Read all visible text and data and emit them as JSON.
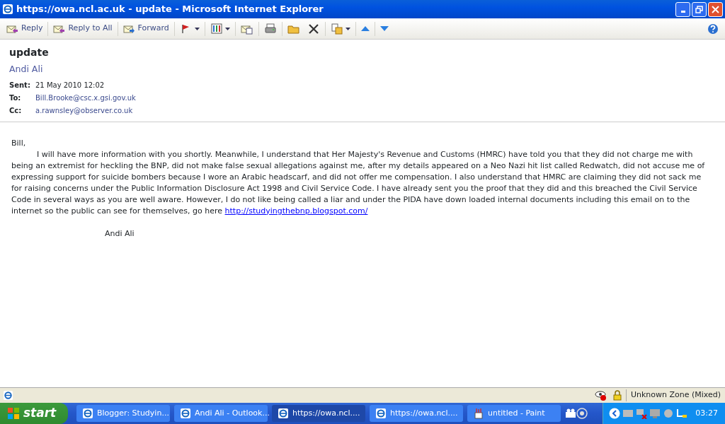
{
  "window": {
    "title": "https://owa.ncl.ac.uk - update - Microsoft Internet Explorer"
  },
  "toolbar": [
    {
      "label": "Reply",
      "has_menu": false
    },
    {
      "label": "Reply to All",
      "has_menu": false
    },
    {
      "label": "Forward",
      "has_menu": false
    },
    {
      "has_menu": true
    },
    {
      "has_menu": true
    },
    {
      "has_menu": false
    },
    {
      "has_menu": false
    },
    {
      "has_menu": false
    },
    {
      "has_menu": false
    },
    {
      "has_menu": true
    },
    {
      "has_menu": false
    },
    {
      "has_menu": false
    }
  ],
  "message": {
    "subject": "update",
    "sender": "Andi Ali",
    "fields": [
      {
        "label": "Sent:",
        "value": "21 May 2010 12:02",
        "kind": "text"
      },
      {
        "label": "To:",
        "value": "Bill.Brooke@csc.x.gsi.gov.uk",
        "kind": "address"
      },
      {
        "label": "Cc:",
        "value": "a.rawnsley@observer.co.uk",
        "kind": "address"
      }
    ],
    "greeting": "Bill,",
    "body": "I will have more information with you shortly. Meanwhile, I understand that Her Majesty's Revenue and Customs (HMRC) have told you that they did not charge me with being an extremist for heckling the BNP, did not make false sexual allegations against me, after my details appeared on a Neo Nazi hit list called Redwatch, did not  accuse me of expressing support for suicide bombers because I wore an Arabic headscarf, and did not offer me compensation. I also understand that HMRC are claiming they did not sack me for raising concerns under the Public Information Disclosure Act 1998 and Civil Service Code. I have already sent you the proof that they did and this breached the Civil Service Code in several ways as you are well aware. However, I do not like being called a liar and under the PIDA have down loaded internal documents including this email on to the internet so the public can see for themselves, go here",
    "link": "http://studyingthebnp.blogspot.com/",
    "signature": "Andi Ali"
  },
  "status_bar": {
    "zone": "Unknown Zone (Mixed)"
  },
  "taskbar": {
    "start": "start",
    "buttons": [
      {
        "label": "Blogger: Studyin...",
        "selected": false
      },
      {
        "label": "Andi Ali - Outlook...",
        "selected": false
      },
      {
        "label": "https://owa.ncl....",
        "selected": true
      },
      {
        "label": "https://owa.ncl....",
        "selected": false
      },
      {
        "label": "untitled - Paint",
        "selected": false
      }
    ],
    "clock": "03:27"
  }
}
